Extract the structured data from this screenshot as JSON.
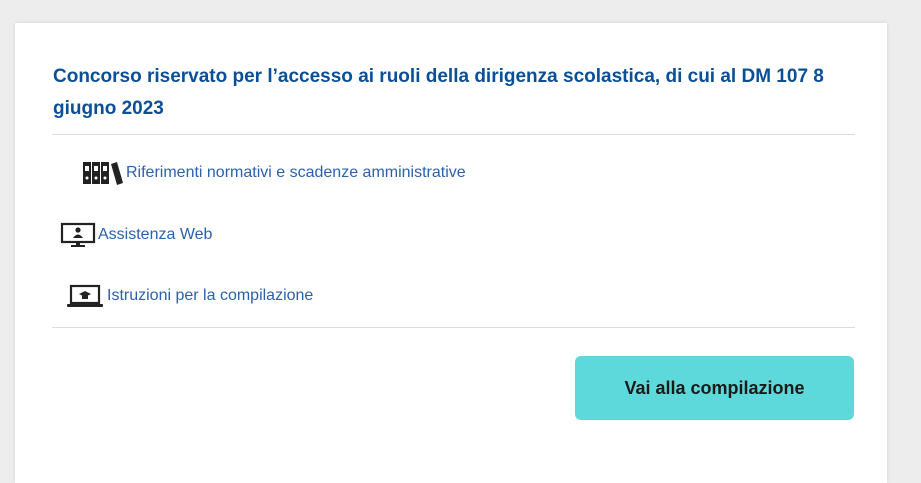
{
  "card": {
    "title": "Concorso riservato per l’accesso ai ruoli della dirigenza scolastica, di cui al DM 107 8 giugno 2023",
    "links": [
      {
        "label": "Riferimenti normativi e scadenze amministrative",
        "icon": "binders-icon"
      },
      {
        "label": "Assistenza Web",
        "icon": "web-support-monitor-icon"
      },
      {
        "label": "Istruzioni per la compilazione",
        "icon": "instructions-laptop-icon"
      }
    ],
    "cta_label": "Vai alla compilazione"
  },
  "colors": {
    "title": "#0b4f97",
    "link": "#2a62ad",
    "cta_background": "#5dd9dc",
    "page_background": "#ededed"
  }
}
